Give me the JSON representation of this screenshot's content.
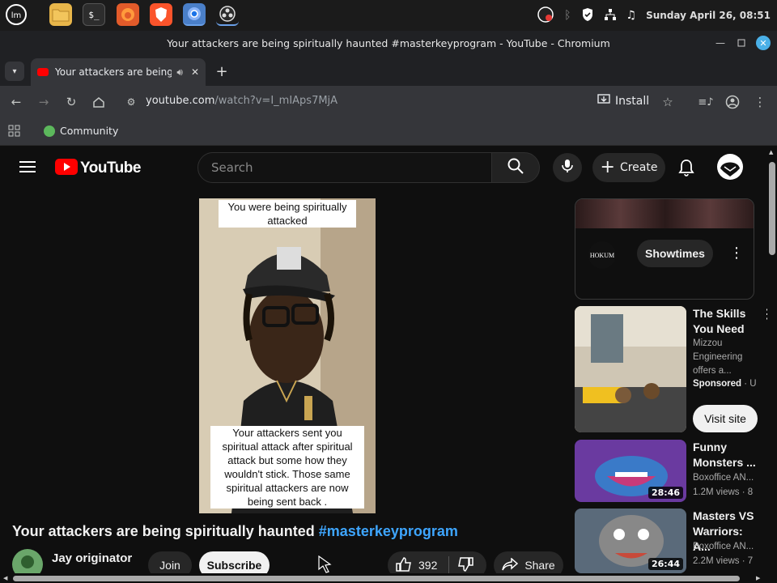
{
  "taskbar": {
    "clock": "Sunday April 26, 08:51"
  },
  "window": {
    "title": "Your attackers are being spiritually haunted #masterkeyprogram - YouTube - Chromium"
  },
  "tab": {
    "title": "Your attackers are being"
  },
  "toolbar": {
    "url_host": "youtube.com",
    "url_path": "/watch?v=I_mIAps7MjA",
    "install_label": "Install"
  },
  "bookmarks": {
    "community": "Community"
  },
  "youtube": {
    "logo": "YouTube",
    "search_placeholder": "Search",
    "create_label": "Create",
    "video": {
      "caption_top": "You were being spiritually attacked",
      "caption_bottom": "Your attackers sent you spiritual attack after spiritual attack but some how they wouldn't stick. Those same spiritual attackers are now being sent back .",
      "title_main": "Your attackers are being spiritually haunted ",
      "title_hashtag": "#masterkeyprogram",
      "channel": "Jay originator",
      "join_label": "Join",
      "subscribe_label": "Subscribe",
      "likes": "392",
      "share_label": "Share"
    },
    "ad_banner": {
      "brand": "HOKUM",
      "button": "Showtimes"
    },
    "recommendations": [
      {
        "title": "The Skills You Need",
        "channel": "Mizzou Engineering offers a...",
        "meta": "Sponsored",
        "meta_extra": "· U",
        "button": "Visit site"
      },
      {
        "title": "Funny Monsters ...",
        "channel": "Boxoffice AN...",
        "meta": "1.2M views · 8",
        "duration": "28:46"
      },
      {
        "title": "Masters VS Warriors: A...",
        "channel": "Boxoffice AN...",
        "meta": "2.2M views · 7",
        "duration": "26:44"
      }
    ]
  }
}
